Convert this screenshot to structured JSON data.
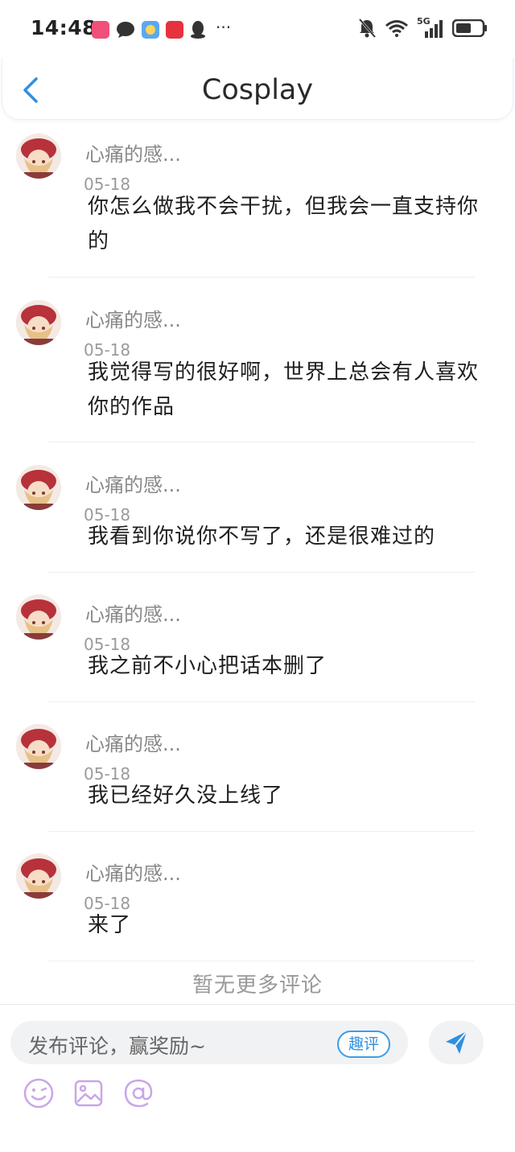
{
  "status_bar": {
    "time": "14:48",
    "more": "···",
    "network": "5G"
  },
  "header": {
    "title": "Cosplay"
  },
  "comments": [
    {
      "user": "心痛的感...",
      "date": "05-18",
      "text": "你怎么做我不会干扰，但我会一直支持你的"
    },
    {
      "user": "心痛的感...",
      "date": "05-18",
      "text": "我觉得写的很好啊，世界上总会有人喜欢你的作品"
    },
    {
      "user": "心痛的感...",
      "date": "05-18",
      "text": "我看到你说你不写了，还是很难过的"
    },
    {
      "user": "心痛的感...",
      "date": "05-18",
      "text": "我之前不小心把话本删了"
    },
    {
      "user": "心痛的感...",
      "date": "05-18",
      "text": "我已经好久没上线了"
    },
    {
      "user": "心痛的感...",
      "date": "05-18",
      "text": "来了"
    }
  ],
  "footer_note": "暂无更多评论",
  "composer": {
    "placeholder": "发布评论，赢奖励~",
    "badge": "趣评"
  },
  "colors": {
    "accent": "#2f8fe0",
    "toolbar_icon": "#c9a6ea"
  },
  "icons": [
    "back-arrow-icon",
    "send-icon",
    "emoji-icon",
    "image-icon",
    "mention-icon"
  ]
}
